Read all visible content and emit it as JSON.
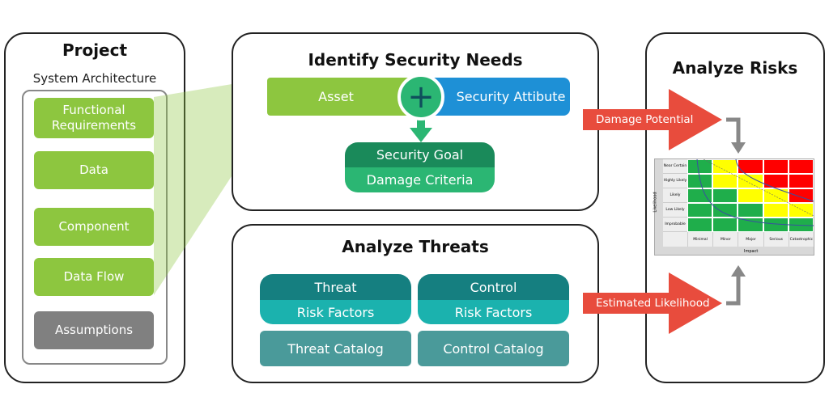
{
  "project": {
    "title": "Project",
    "subtitle": "System Architecture",
    "items": [
      "Functional Requirements",
      "Data",
      "Component",
      "Data Flow"
    ],
    "assumptions": "Assumptions"
  },
  "identify": {
    "title": "Identify Security Needs",
    "asset": "Asset",
    "attribute": "Security Attibute",
    "goal": "Security Goal",
    "criteria": "Damage Criteria",
    "plus_icon": "plus-icon"
  },
  "threats": {
    "title": "Analyze Threats",
    "threat": "Threat",
    "threat_factors": "Risk Factors",
    "control": "Control",
    "control_factors": "Risk Factors",
    "threat_catalog": "Threat Catalog",
    "control_catalog": "Control Catalog"
  },
  "arrows": {
    "damage": "Damage Potential",
    "likelihood": "Estimated Likelihood"
  },
  "risks": {
    "title": "Analyze Risks",
    "matrix": {
      "ylabel": "Likelihood",
      "xlabel": "Impact",
      "rows": [
        "Near Certain",
        "Highly Likely",
        "Likely",
        "Low Likely",
        "Improbable"
      ],
      "cols": [
        "Minimal",
        "Minor",
        "Major",
        "Serious",
        "Catastrophic"
      ],
      "cells": [
        [
          "G",
          "Y",
          "R",
          "R",
          "R"
        ],
        [
          "G",
          "Y",
          "Y",
          "R",
          "R"
        ],
        [
          "G",
          "G",
          "Y",
          "Y",
          "R"
        ],
        [
          "G",
          "G",
          "G",
          "Y",
          "Y"
        ],
        [
          "G",
          "G",
          "G",
          "G",
          "G"
        ]
      ]
    }
  },
  "colors": {
    "green": "#8dc63f",
    "blue": "#1e90d6",
    "red": "#e84c3d",
    "teal": "#157f80",
    "teal_light": "#1bb2ae",
    "goal": "#1a8a5a",
    "criteria": "#2bb673",
    "grey": "#808080"
  }
}
